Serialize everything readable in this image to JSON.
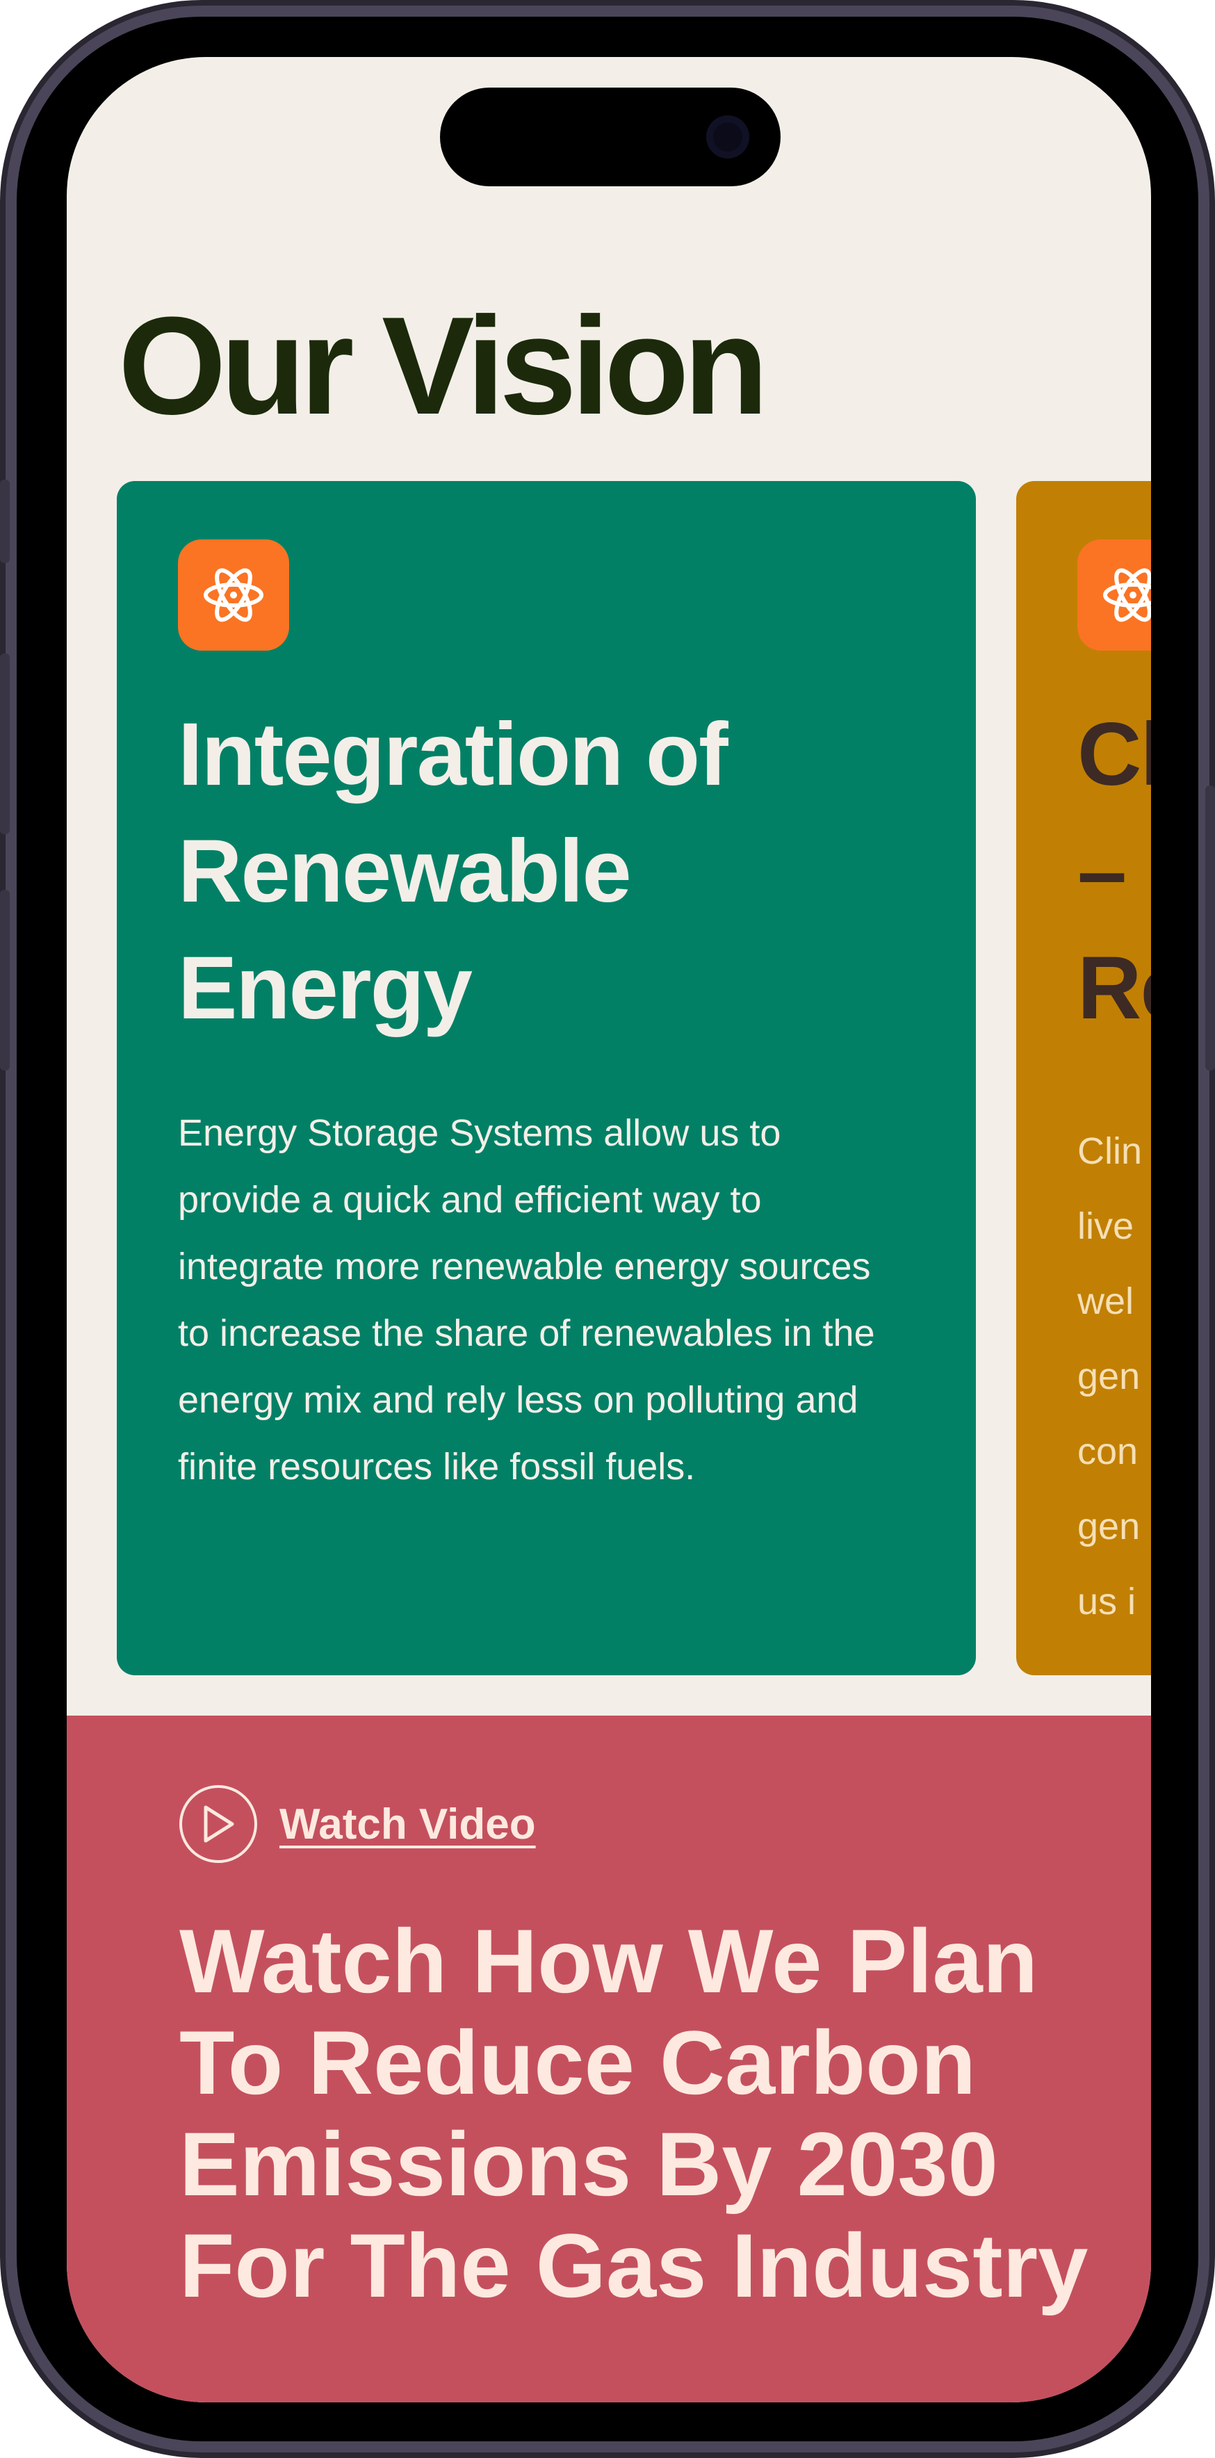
{
  "page": {
    "title": "Our Vision"
  },
  "cards": [
    {
      "icon": "atom-icon",
      "title": "Integration of Renewable Energy",
      "body": "Energy Storage Systems allow us to provide a quick and efficient way to integrate more renewable energy sources to increase the share of renewables in the energy mix and rely less on polluting and finite resources like fossil fuels."
    },
    {
      "icon": "atom-icon",
      "title": "Cl\n– C\nRe",
      "body": "Clin\nlive\nwel\ngen\ncon\ngen\nus i"
    }
  ],
  "video": {
    "link_label": "Watch Video",
    "heading": "Watch How We Plan To Reduce Carbon Emissions By 2030 For The Gas Industry"
  },
  "colors": {
    "background": "#f3efe8",
    "title": "#1c2a0b",
    "card_green": "#028066",
    "card_amber": "#c18004",
    "icon_orange": "#fa7423",
    "video_section": "#c4505e",
    "video_text": "#fde9df"
  }
}
